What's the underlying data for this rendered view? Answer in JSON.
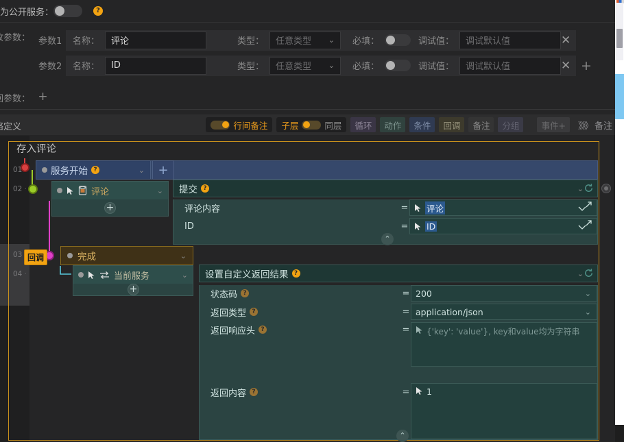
{
  "header": {
    "public_service_label": "为公开服务：",
    "public_service_toggle": "off",
    "help_icon": "?"
  },
  "params": {
    "incoming_label": "收参数：",
    "return_label": "回参数：",
    "add_return_param": "+",
    "rows": [
      {
        "index_label": "参数1",
        "name_label": "名称：",
        "name_value": "评论",
        "type_label": "类型：",
        "type_value": "任意类型",
        "required_label": "必填：",
        "required_toggle": "off",
        "debug_label": "调试值：",
        "debug_placeholder": "调试默认值",
        "remove": "✕",
        "add": ""
      },
      {
        "index_label": "参数2",
        "name_label": "名称：",
        "name_value": "ID",
        "type_label": "类型：",
        "type_value": "任意类型",
        "required_label": "必填：",
        "required_toggle": "off",
        "debug_label": "调试值：",
        "debug_placeholder": "调试默认值",
        "remove": "✕",
        "add": "+"
      }
    ]
  },
  "toolbar": {
    "left_label": "络定义",
    "inline_memo": "行间备注",
    "sublayer": "子层",
    "samelayer": "同层",
    "buttons": [
      {
        "label": "循环",
        "style": "b1"
      },
      {
        "label": "动作",
        "style": "b2"
      },
      {
        "label": "条件",
        "style": "b3"
      },
      {
        "label": "回调",
        "style": "b4"
      },
      {
        "label": "备注",
        "style": "b5"
      },
      {
        "label": "分组",
        "style": "b6"
      },
      {
        "label": "事件+",
        "style": "b7"
      }
    ],
    "memo_label": "备注",
    "memo_chevrons": "》》》"
  },
  "canvas": {
    "flow_title": "存入评论",
    "line_numbers": [
      "01",
      "02",
      "03",
      "04"
    ],
    "callback_badge": "回调",
    "nodes": {
      "service_start": {
        "label": "服务开始",
        "help": "?",
        "add": "+"
      },
      "comment_db": {
        "label": "评论",
        "add": "+"
      },
      "complete": {
        "label": "完成"
      },
      "current_service": {
        "label": "当前服务",
        "add": "+"
      }
    },
    "submit_panel": {
      "title": "提交",
      "help": "?",
      "collapse": "⌃",
      "fields": [
        {
          "name": "评论内容",
          "eq": "=",
          "value": "评论",
          "kind": "token"
        },
        {
          "name": "ID",
          "eq": "=",
          "value": "ID",
          "kind": "token"
        }
      ]
    },
    "return_panel": {
      "title": "设置自定义返回结果",
      "help": "?",
      "collapse": "⌃",
      "fields": [
        {
          "name": "状态码",
          "help": "?",
          "eq": "=",
          "value": "200",
          "kind": "select"
        },
        {
          "name": "返回类型",
          "help": "?",
          "eq": "=",
          "value": "application/json",
          "kind": "select"
        },
        {
          "name": "返回响应头",
          "help": "?",
          "eq": "=",
          "value": "{'key': 'value'}, key和value均为字符串",
          "kind": "placeholder"
        },
        {
          "name": "返回内容",
          "help": "?",
          "eq": "=",
          "value": "1",
          "kind": "plain"
        }
      ]
    }
  },
  "colors": {
    "accent_orange": "#f2a312",
    "frame_gold": "#c8901c",
    "blue_header": "#2f4266",
    "teal_panel": "#2b4442",
    "gold_node": "#3f3117",
    "token_blue": "#2c5a8f"
  }
}
